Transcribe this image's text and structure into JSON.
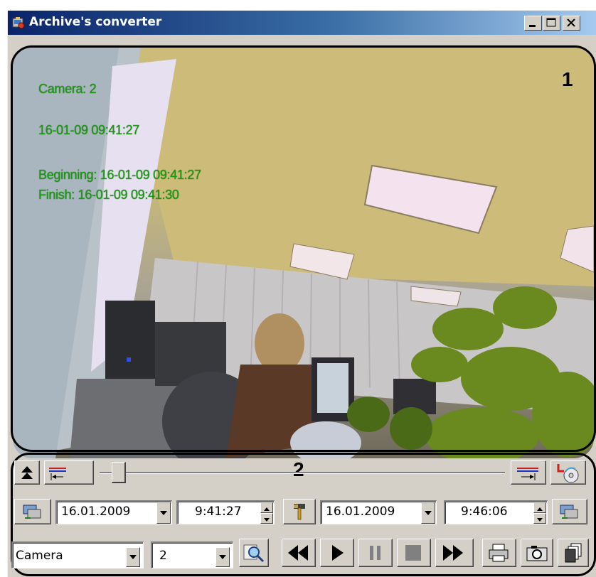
{
  "window": {
    "title": "Archive's converter"
  },
  "video": {
    "camera_line": "Camera: 2",
    "timestamp": "16-01-09 09:41:27",
    "beginning_line": "Beginning: 16-01-09 09:41:27",
    "finish_line": "Finish: 16-01-09 09:41:30"
  },
  "callouts": {
    "video_area": "1",
    "controls_area": "2"
  },
  "controls": {
    "start_date": "16.01.2009",
    "start_time": "9:41:27",
    "end_date": "16.01.2009",
    "end_time": "9:46:06",
    "source_type": "Camera",
    "source_id": "2",
    "slider_position": 0.02
  },
  "icons": {
    "app": "archive-converter-icon",
    "minimize": "minimize-icon",
    "maximize": "maximize-icon",
    "close": "close-icon",
    "eject": "eject-icon",
    "set_start": "set-start-marker-icon",
    "set_end": "set-end-marker-icon",
    "export": "export-disc-icon",
    "left_time_sync": "time-sync-icon",
    "hammer": "hammer-icon",
    "right_time_sync": "time-sync-icon",
    "search": "search-icon",
    "rewind": "rewind-icon",
    "play": "play-icon",
    "pause": "pause-icon",
    "stop": "stop-icon",
    "fast_forward": "fast-forward-icon",
    "print": "print-icon",
    "snapshot": "camera-snapshot-icon",
    "copy": "copy-files-icon"
  },
  "colors": {
    "overlay_text": "#1a9a10",
    "titlebar_start": "#0a246a",
    "titlebar_end": "#a6caf0"
  }
}
